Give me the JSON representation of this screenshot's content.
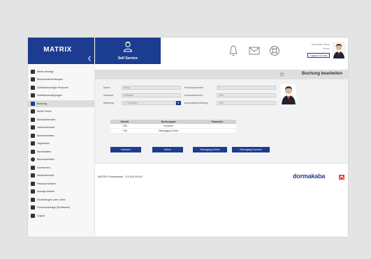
{
  "brand": {
    "title": "MATRIX"
  },
  "module": {
    "label": "Self Service"
  },
  "user": {
    "name": "Sebastian Nessy",
    "role": "Nessy",
    "logout_label": "Logout in 30 min"
  },
  "sidebar": {
    "items": [
      {
        "label": "Meine Anzeige",
        "icon": "monitor-icon"
      },
      {
        "label": "Besucheranmeldungen",
        "icon": "visitor-icon"
      },
      {
        "label": "Zutrittsberechtigte Personen",
        "icon": "people-icon"
      },
      {
        "label": "Zutrittsberechtigungen",
        "icon": "calendar-icon"
      },
      {
        "label": "Buchung",
        "icon": "booking-icon",
        "active": true
      },
      {
        "label": "Meine Ferien",
        "icon": "vacation-icon"
      },
      {
        "label": "Monatsübersicht",
        "icon": "chart-icon"
      },
      {
        "label": "Jahresübersicht",
        "icon": "people-chart-icon"
      },
      {
        "label": "Abwesenheiten",
        "icon": "pin-icon"
      },
      {
        "label": "Tageslisten",
        "icon": "line-chart-icon"
      },
      {
        "label": "Monatslisten",
        "icon": "line-chart-icon"
      },
      {
        "label": "Besonderheiten",
        "icon": "alert-icon"
      },
      {
        "label": "Korrekturen",
        "icon": "wrench-icon"
      },
      {
        "label": "Meldeübersicht",
        "icon": "inbox-icon"
      },
      {
        "label": "Passwort ändern",
        "icon": "key-icon"
      },
      {
        "label": "Anzeige ändern",
        "icon": "pencil-icon"
      },
      {
        "label": "Einstellungen Liste Listen",
        "icon": "list-icon"
      },
      {
        "label": "Formularanträge (Sichtbaren)",
        "icon": "printer-icon"
      },
      {
        "label": "Logout",
        "icon": "logout-icon"
      }
    ]
  },
  "page": {
    "title": "Buchung bearbeiten"
  },
  "form": {
    "name_label": "Name",
    "name_value": "Nessy",
    "vorname_label": "Vorname",
    "vorname_value": "Sebastian",
    "abteilung_label": "Abteilung",
    "abteilung_value": "1 - Produktion",
    "personalnummer_label": "Personalnummer",
    "personalnummer_value": "0",
    "ausweisnummer_label": "Ausweisnummer",
    "ausweisnummer_value": "1000",
    "ausweisbeschriftung_label": "Ausweisbeschriftung",
    "ausweisbeschriftung_value": "1000"
  },
  "table": {
    "headers": [
      "Uhrzeit",
      "Buchungsart",
      "Parameter"
    ],
    "rows": [
      [
        "7:55",
        "Kommen",
        ""
      ],
      [
        "7:58",
        "Dienstgang Gehen",
        ""
      ]
    ]
  },
  "buttons": {
    "kommen": "Kommen",
    "gehen": "Gehen",
    "dienstgang_gehen": "Dienstgang Gehen",
    "dienstgang_kommen": "Dienstgang Kommen"
  },
  "footer": {
    "text": "MATRIX Professional - 3.8.410.20143",
    "logo": "dormakaba"
  },
  "colors": {
    "primary": "#1b3c8f",
    "sidebar_bg": "#f7f7f7",
    "header_bg": "#dedede",
    "form_bg": "#f2f2f2",
    "logo_accent": "#e4322b"
  }
}
